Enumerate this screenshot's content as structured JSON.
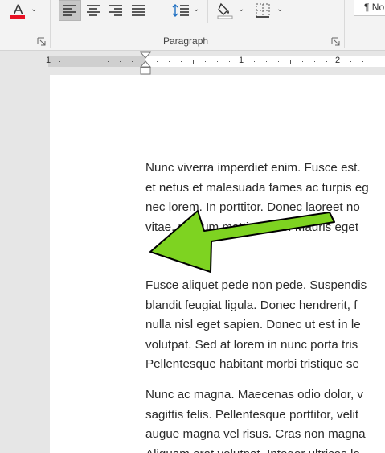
{
  "ribbon": {
    "font_color_button": {
      "glyph": "A",
      "underline_color": "#e81123",
      "icon": "font-color-icon"
    },
    "paragraph_group_label": "Paragraph",
    "buttons": [
      {
        "name": "align-left-button",
        "icon": "align-left-icon",
        "active": true
      },
      {
        "name": "center-button",
        "icon": "align-center-icon",
        "active": false
      },
      {
        "name": "align-right-button",
        "icon": "align-right-icon",
        "active": false
      },
      {
        "name": "justify-button",
        "icon": "justify-icon",
        "active": false
      },
      {
        "name": "line-spacing-button",
        "icon": "line-spacing-icon",
        "active": false
      },
      {
        "name": "shading-button",
        "icon": "paint-bucket-icon",
        "active": false
      },
      {
        "name": "borders-button",
        "icon": "borders-icon",
        "active": false
      }
    ],
    "styles_preview": "¶ No"
  },
  "ruler": {
    "numbers": [
      "1",
      "1",
      "2"
    ]
  },
  "document": {
    "paragraphs": [
      [
        "Nunc viverra imperdiet enim. Fusce est.",
        "et netus et malesuada fames ac turpis eg",
        "nec lorem. In porttitor. Donec laoreet no",
        "vitae, pretium mattis, nunc. Mauris eget"
      ],
      [
        "Fusce aliquet pede non pede. Suspendis",
        "blandit feugiat ligula. Donec hendrerit, f",
        "nulla nisl eget sapien. Donec ut est in le",
        "volutpat. Sed at lorem in nunc porta tris",
        "Pellentesque habitant morbi tristique se"
      ],
      [
        "Nunc ac magna. Maecenas odio dolor, v",
        "sagittis felis. Pellentesque porttitor, velit",
        "augue magna vel risus. Cras non magna",
        "Aliquam erat volutpat. Integer ultrices lo"
      ]
    ]
  },
  "annotation": {
    "color": "#7ed321",
    "outline": "#000000"
  },
  "colors": {
    "ribbon_bg": "#f3f3f3",
    "canvas_bg": "#e6e6e6",
    "page_bg": "#ffffff",
    "active_button_bg": "#c6c6c6"
  }
}
